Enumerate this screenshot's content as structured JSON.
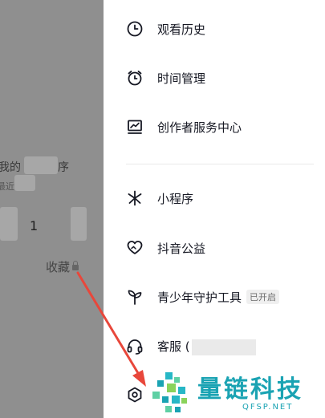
{
  "background": {
    "fragment_line1": "我的",
    "fragment_line1_tail": "序",
    "fragment_line2": "最近",
    "count": "1",
    "favorites_label": "收藏"
  },
  "menu": {
    "items": [
      {
        "label": "观看历史",
        "icon": "clock-icon"
      },
      {
        "label": "时间管理",
        "icon": "alarm-clock-icon"
      },
      {
        "label": "创作者服务中心",
        "icon": "chart-icon"
      },
      {
        "label": "小程序",
        "icon": "asterisk-icon"
      },
      {
        "label": "抖音公益",
        "icon": "heart-hands-icon"
      },
      {
        "label": "青少年守护工具",
        "icon": "sprout-icon",
        "badge": "已开启"
      },
      {
        "label": "客服 (",
        "icon": "headset-icon"
      },
      {
        "label": "",
        "icon": "settings-hexagon-icon"
      }
    ]
  },
  "watermark": {
    "text": "量链科技",
    "sub": "QFSP.NET"
  },
  "colors": {
    "accent_watermark": "#1aa3b3",
    "arrow": "#e8473b"
  }
}
